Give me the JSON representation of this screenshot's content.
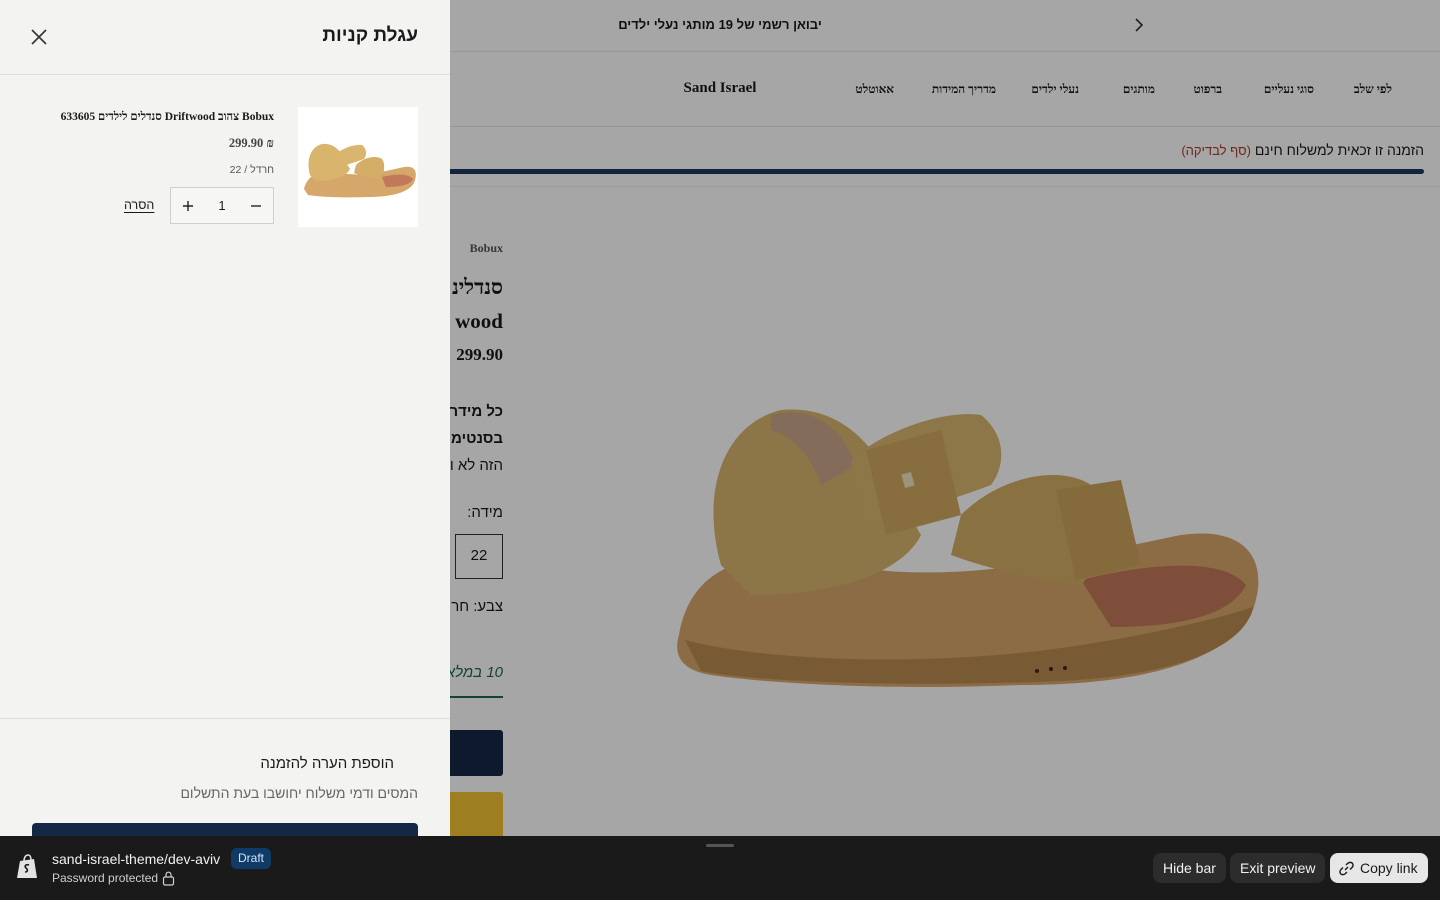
{
  "announcement": {
    "text": "יבואן רשמי של 19 מותגי נעלי ילדים"
  },
  "header": {
    "logo": "Sand Israel",
    "nav": [
      "לפי שלב",
      "סוגי נעליים",
      "ברפוט",
      "מותגים",
      "נעלי ילדים",
      "מדריך המידות",
      "אאוטלט"
    ]
  },
  "shipping": {
    "text": "הזמנה זו זכאית למשלוח חינם",
    "note": "(סף לבדיקה)",
    "progress_fraction": 1.0
  },
  "product": {
    "brand": "Bobux",
    "title_line1": "סנדלינ",
    "title_line2": "wood",
    "price": "299.90",
    "desc_line1": "כל מידר",
    "desc_line2": "בסנטימ",
    "desc_line3": "הזה לא ו",
    "size_label": "מידה:",
    "size_value": "22",
    "color_label": "צבע: חר",
    "installments": "10 במלא"
  },
  "cart": {
    "title": "עגלת קניות",
    "item": {
      "title": "סנדלים לילדים 633605 Driftwood צהוב Bobux",
      "price": "299.90 ₪",
      "variant": "22 / חרדל",
      "quantity": "1",
      "remove_label": "הסרה"
    },
    "add_note_label": "הוספת הערה להזמנה",
    "tax_note": "המסים ודמי משלוח יחושבו בעת התשלום"
  },
  "preview_bar": {
    "theme_name": "sand-israel-theme/dev-aviv",
    "badge": "Draft",
    "password_text": "Password protected",
    "hide_bar": "Hide bar",
    "exit_preview": "Exit preview",
    "copy_link": "Copy link"
  },
  "colors": {
    "navy": "#152746",
    "yellow": "#f1c232",
    "drawer_bg": "#f3f3f1",
    "bar_bg": "#1a1a1a",
    "shoe": "#d6b064"
  },
  "icons": [
    "chevron-right-icon",
    "close-icon",
    "plus-icon",
    "minus-icon",
    "shopify-bag-icon",
    "lock-icon",
    "link-icon"
  ]
}
